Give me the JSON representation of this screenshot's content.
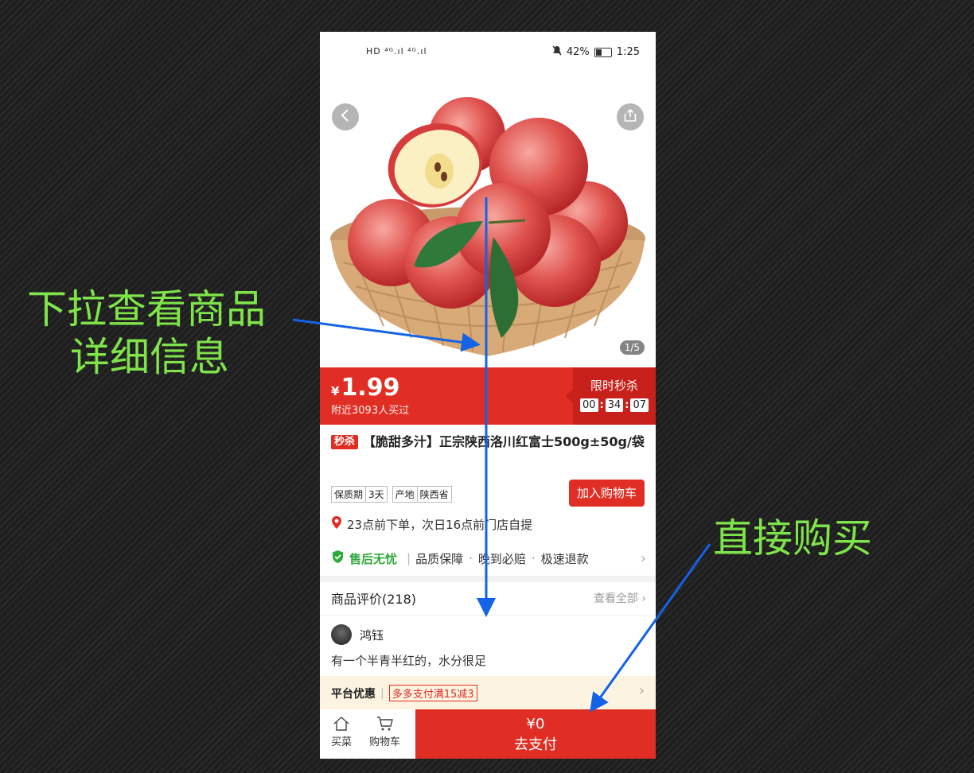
{
  "status_bar": {
    "left_indicators": "HD ⁴ᴳ.ıl ⁴ᴳ.ıl",
    "battery": "42%",
    "time": "1:25"
  },
  "image_counter": "1/5",
  "price": {
    "symbol": "¥",
    "value": "1.99",
    "buyers": "附近3093人买过"
  },
  "flash_sale": {
    "title": "限时秒杀",
    "hours": "00",
    "minutes": "34",
    "seconds": "07"
  },
  "product": {
    "tag": "秒杀",
    "title": "【脆甜多汁】正宗陕西洛川红富士500g±50g/袋"
  },
  "specs": [
    {
      "label": "保质期",
      "value": "3天"
    },
    {
      "label": "产地",
      "value": "陕西省"
    }
  ],
  "add_to_cart": "加入购物车",
  "pickup": "23点前下单，次日16点前门店自提",
  "guarantee": {
    "title": "售后无忧",
    "items": [
      "品质保障",
      "晚到必赔",
      "极速退款"
    ]
  },
  "reviews": {
    "heading": "商品评价(218)",
    "view_all": "查看全部",
    "first": {
      "name": "鸿钰",
      "text": "有一个半青半红的，水分很足"
    }
  },
  "promo": {
    "label": "平台优惠",
    "tag": "多多支付满15减3"
  },
  "bottom_nav": {
    "home": "买菜",
    "cart": "购物车",
    "pay_amount": "¥0",
    "pay_label": "去支付"
  },
  "annotations": {
    "scroll_line1": "下拉查看商品",
    "scroll_line2": "详细信息",
    "buy_now": "直接购买",
    "arrow_color": "#1463e6",
    "text_color": "#7fe34a"
  },
  "colors": {
    "brand_red": "#e02e24",
    "guarantee_green": "#2eaa3a",
    "promo_bg": "#fdf3e1"
  }
}
